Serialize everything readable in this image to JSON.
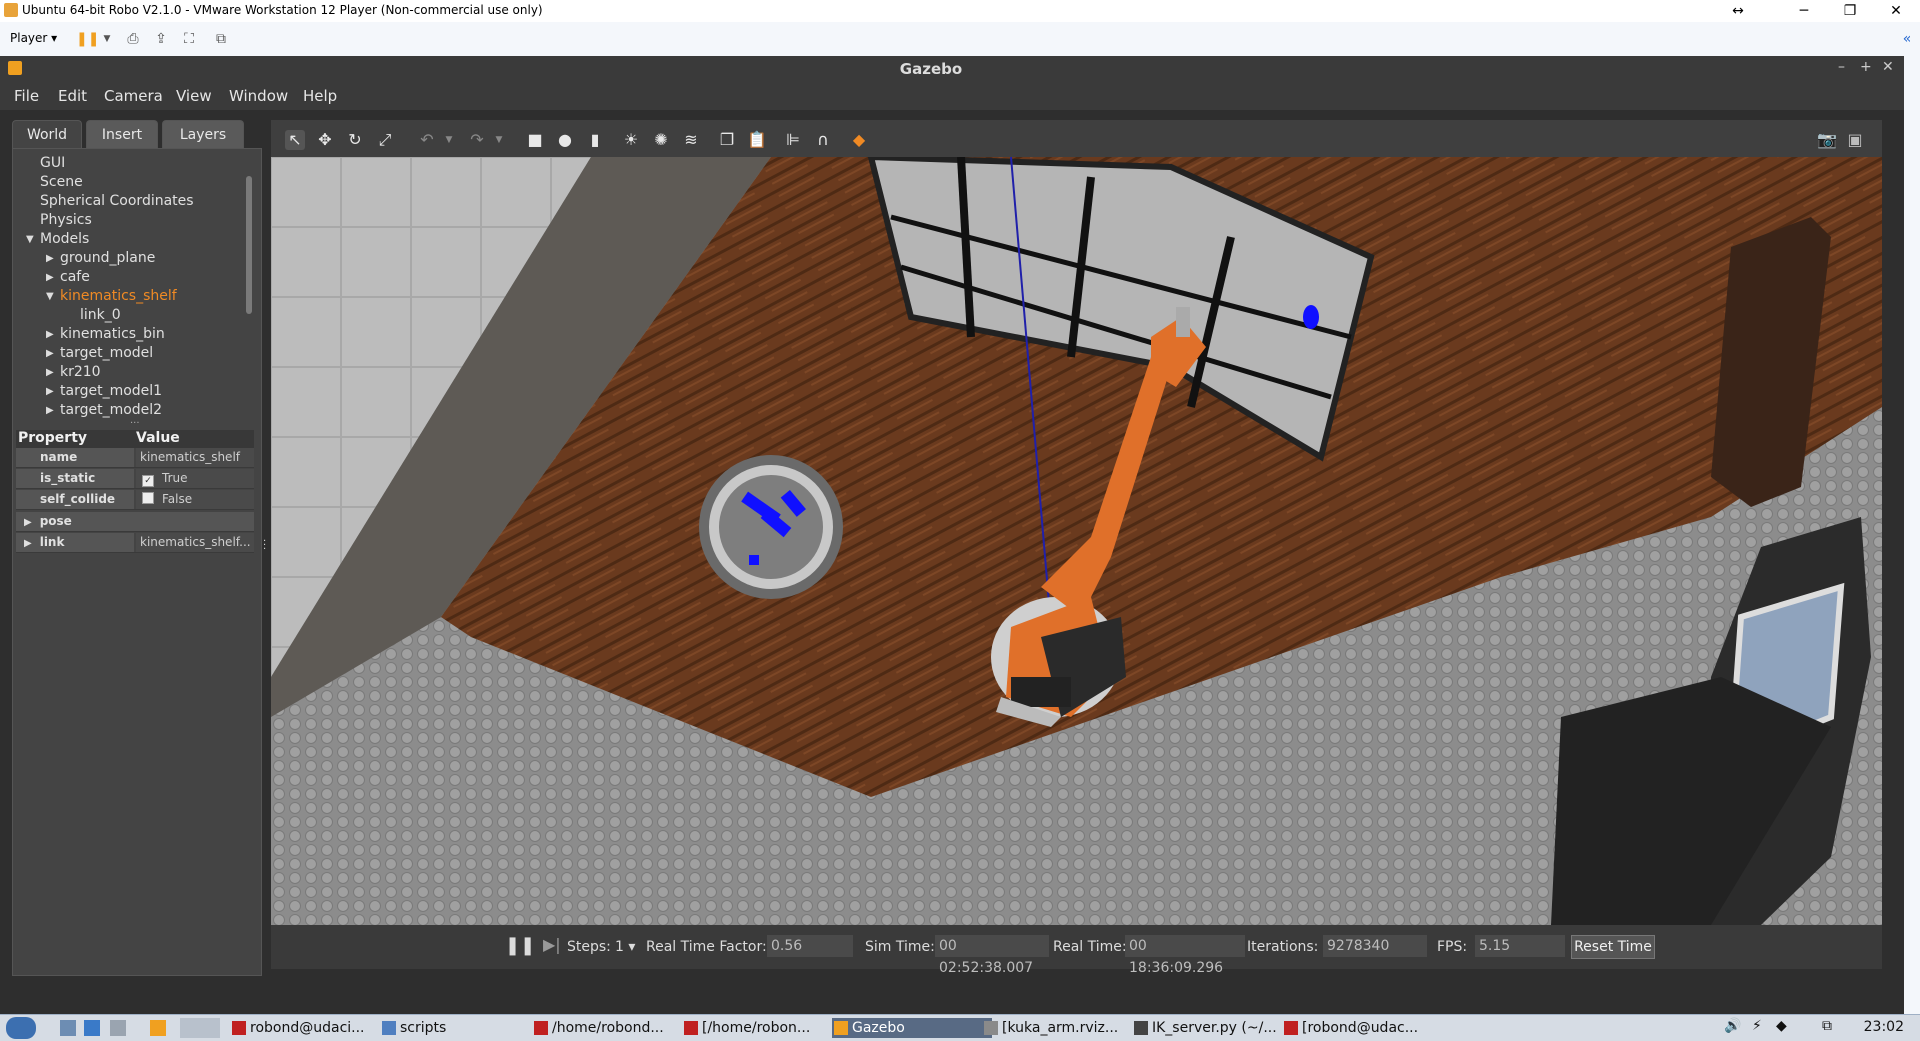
{
  "vm": {
    "title": "Ubuntu 64-bit Robo V2.1.0 - VMware Workstation 12 Player (Non-commercial use only)",
    "player_menu": "Player"
  },
  "gazebo": {
    "title": "Gazebo",
    "menu": [
      "File",
      "Edit",
      "Camera",
      "View",
      "Window",
      "Help"
    ],
    "tabs": [
      "World",
      "Insert",
      "Layers"
    ],
    "tree": [
      {
        "label": "GUI",
        "level": 0,
        "arrow": ""
      },
      {
        "label": "Scene",
        "level": 0,
        "arrow": ""
      },
      {
        "label": "Spherical Coordinates",
        "level": 0,
        "arrow": ""
      },
      {
        "label": "Physics",
        "level": 0,
        "arrow": ""
      },
      {
        "label": "Models",
        "level": 0,
        "arrow": "open"
      },
      {
        "label": "ground_plane",
        "level": 1,
        "arrow": "closed"
      },
      {
        "label": "cafe",
        "level": 1,
        "arrow": "closed"
      },
      {
        "label": "kinematics_shelf",
        "level": 1,
        "arrow": "open",
        "selected": true
      },
      {
        "label": "link_0",
        "level": 2,
        "arrow": ""
      },
      {
        "label": "kinematics_bin",
        "level": 1,
        "arrow": "closed"
      },
      {
        "label": "target_model",
        "level": 1,
        "arrow": "closed"
      },
      {
        "label": "kr210",
        "level": 1,
        "arrow": "closed"
      },
      {
        "label": "target_model1",
        "level": 1,
        "arrow": "closed"
      },
      {
        "label": "target_model2",
        "level": 1,
        "arrow": "closed"
      }
    ],
    "properties": {
      "header_property": "Property",
      "header_value": "Value",
      "rows": [
        {
          "key": "name",
          "value": "kinematics_shelf"
        },
        {
          "key": "is_static",
          "value": "True",
          "checkbox": true
        },
        {
          "key": "self_collide",
          "value": "False",
          "checkbox": false
        },
        {
          "key": "pose",
          "value": "",
          "expandable": true
        },
        {
          "key": "link",
          "value": "kinematics_shelf...",
          "expandable": true
        }
      ]
    },
    "bottom": {
      "steps_label": "Steps:",
      "steps_value": "1",
      "rtf_label": "Real Time Factor:",
      "rtf_value": "0.56",
      "sim_label": "Sim Time:",
      "sim_value": "00 02:52:38.007",
      "real_label": "Real Time:",
      "real_value": "00 18:36:09.296",
      "iter_label": "Iterations:",
      "iter_value": "9278340",
      "fps_label": "FPS:",
      "fps_value": "5.15",
      "reset_label": "Reset Time"
    }
  },
  "taskbar": {
    "tasks": [
      "robond@udaci...",
      "scripts",
      "/home/robond...",
      "[/home/robon...",
      "Gazebo",
      "[kuka_arm.rviz...",
      "IK_server.py (~/...",
      "[robond@udac..."
    ],
    "clock": "23:02"
  },
  "colors": {
    "accent_selected": "#f08a24",
    "wood": "#6b3a1c",
    "robot": "#e0702a",
    "target": "#1010ff"
  }
}
